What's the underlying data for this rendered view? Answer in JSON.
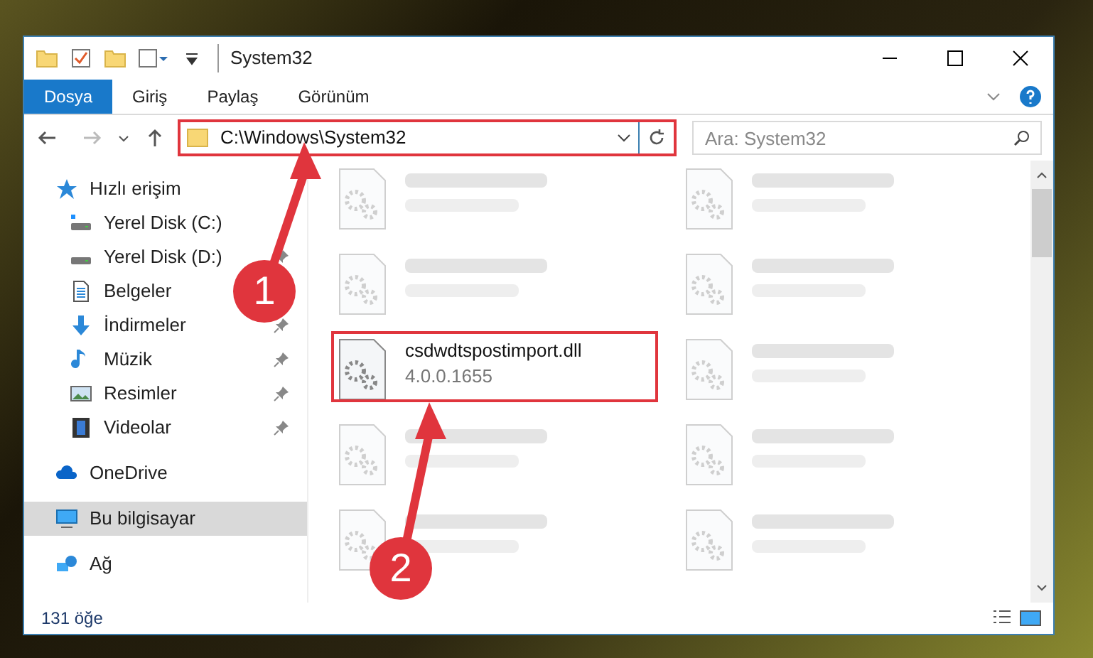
{
  "window": {
    "title": "System32"
  },
  "ribbon": {
    "tabs": [
      {
        "label": "Dosya",
        "selected": true
      },
      {
        "label": "Giriş",
        "selected": false
      },
      {
        "label": "Paylaş",
        "selected": false
      },
      {
        "label": "Görünüm",
        "selected": false
      }
    ]
  },
  "address": {
    "path": "C:\\Windows\\System32",
    "highlighted": true
  },
  "search": {
    "placeholder": "Ara: System32"
  },
  "sidebar": {
    "items": [
      {
        "label": "Hızlı erişim",
        "kind": "star",
        "selected": false,
        "children": [
          {
            "label": "Yerel Disk (C:)",
            "kind": "systemdrive",
            "selected": false
          },
          {
            "label": "Yerel Disk (D:)",
            "kind": "drive",
            "selected": false,
            "pinned": true
          },
          {
            "label": "Belgeler",
            "kind": "document",
            "selected": false
          },
          {
            "label": "İndirmeler",
            "kind": "download",
            "selected": false,
            "pinned": true
          },
          {
            "label": "Müzik",
            "kind": "music",
            "selected": false,
            "pinned": true
          },
          {
            "label": "Resimler",
            "kind": "picture",
            "selected": false,
            "pinned": true
          },
          {
            "label": "Videolar",
            "kind": "film",
            "selected": false,
            "pinned": true
          }
        ]
      },
      {
        "label": "OneDrive",
        "kind": "cloud",
        "selected": false
      },
      {
        "label": "Bu bilgisayar",
        "kind": "computer",
        "selected": true
      },
      {
        "label": "Ağ",
        "kind": "network",
        "selected": false
      }
    ]
  },
  "files": [
    {
      "kind": "blurred"
    },
    {
      "kind": "blurred"
    },
    {
      "kind": "blurred"
    },
    {
      "kind": "blurred"
    },
    {
      "kind": "file",
      "name": "csdwdtspostimport.dll",
      "detail": "4.0.0.1655",
      "highlighted": true
    },
    {
      "kind": "blurred"
    },
    {
      "kind": "blurred"
    },
    {
      "kind": "blurred"
    },
    {
      "kind": "blurred"
    },
    {
      "kind": "blurred"
    }
  ],
  "callouts": [
    {
      "number": "1"
    },
    {
      "number": "2"
    }
  ],
  "status_bar": {
    "count": "131 öğe"
  }
}
